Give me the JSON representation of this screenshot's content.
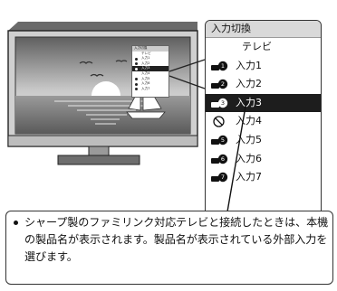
{
  "menu": {
    "title": "入力切換",
    "items": [
      {
        "label": "テレビ",
        "icon": "none",
        "num": ""
      },
      {
        "label": "入力1",
        "icon": "plug-icon",
        "num": "1"
      },
      {
        "label": "入力2",
        "icon": "plug-icon",
        "num": "2"
      },
      {
        "label": "入力3",
        "icon": "plug-icon",
        "num": "3",
        "selected": true
      },
      {
        "label": "入力4",
        "icon": "prohibited-icon",
        "num": ""
      },
      {
        "label": "入力5",
        "icon": "plug-icon",
        "num": "5"
      },
      {
        "label": "入力6",
        "icon": "plug-icon",
        "num": "6"
      },
      {
        "label": "入力7",
        "icon": "plug-icon",
        "num": "7"
      }
    ]
  },
  "caption": {
    "text": "シャープ製のファミリンク対応テレビと接続したときは、本機の製品名が表示されます。製品名が表示されている外部入力を選びます。"
  },
  "colors": {
    "selected_bg": "#1d1d1d",
    "title_bg": "#d9d9d9",
    "border": "#333333"
  }
}
